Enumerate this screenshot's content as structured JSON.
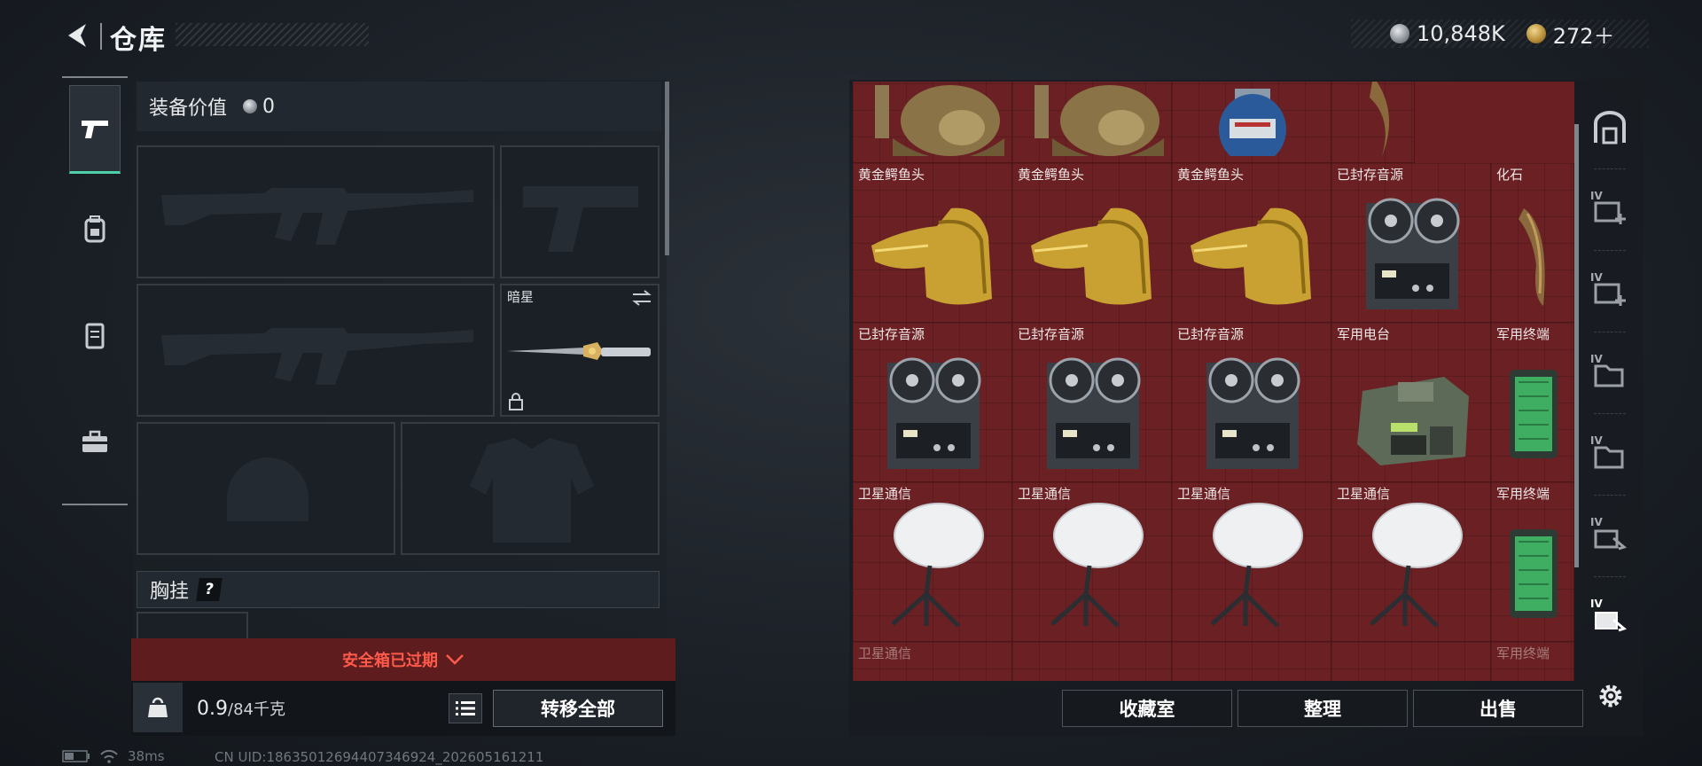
{
  "header": {
    "title": "仓库",
    "currencies": [
      {
        "icon": "silver-coin-icon",
        "value": "10,848K"
      },
      {
        "icon": "gold-token-icon",
        "value": "272＋"
      }
    ]
  },
  "left_tabs": [
    {
      "icon": "pistol-icon",
      "active": true
    },
    {
      "icon": "backpack-icon",
      "active": false
    },
    {
      "icon": "vest-icon",
      "active": false
    },
    {
      "icon": "toolbox-icon",
      "active": false
    }
  ],
  "equipment": {
    "value_label": "装备价值",
    "value": "0",
    "slots": {
      "primary_1": "",
      "pistol": "",
      "primary_2": "",
      "melee": {
        "name": "暗星"
      },
      "helmet": "",
      "armor": ""
    },
    "chest_rig_label": "胸挂",
    "help_label": "?",
    "safe_box_status": "安全箱已过期",
    "weight_current": "0.9",
    "weight_max": "/84千克",
    "transfer_all_label": "转移全部"
  },
  "status": {
    "ping": "38ms",
    "uid": "CN UID:186350126944073469​24_202605161211"
  },
  "stash": {
    "row0": [
      {
        "name": "",
        "icon": "golden-bust-icon"
      },
      {
        "name": "",
        "icon": "golden-bust-icon"
      },
      {
        "name": "",
        "icon": "gas-canister-icon"
      },
      {
        "name": "",
        "icon": "claw-fossil-icon"
      }
    ],
    "row1": [
      {
        "name": "黄金鳄鱼头",
        "icon": "crocodile-head-icon"
      },
      {
        "name": "黄金鳄鱼头",
        "icon": "crocodile-head-icon"
      },
      {
        "name": "黄金鳄鱼头",
        "icon": "crocodile-head-icon"
      },
      {
        "name": "已封存音源",
        "icon": "reel-recorder-icon"
      },
      {
        "name": "化石",
        "icon": "claw-fossil-icon"
      }
    ],
    "row2": [
      {
        "name": "已封存音源",
        "icon": "reel-recorder-icon"
      },
      {
        "name": "已封存音源",
        "icon": "reel-recorder-icon"
      },
      {
        "name": "已封存音源",
        "icon": "reel-recorder-icon"
      },
      {
        "name": "军用电台",
        "icon": "military-radio-icon"
      },
      {
        "name": "军用终端",
        "icon": "military-terminal-icon"
      }
    ],
    "row3": [
      {
        "name": "卫星通信",
        "icon": "satellite-dish-icon"
      },
      {
        "name": "卫星通信",
        "icon": "satellite-dish-icon"
      },
      {
        "name": "卫星通信",
        "icon": "satellite-dish-icon"
      },
      {
        "name": "卫星通信",
        "icon": "satellite-dish-icon"
      },
      {
        "name": "军用终端",
        "icon": "military-terminal-icon"
      }
    ],
    "row4": [
      {
        "name": "卫星通信"
      },
      {
        "name": ""
      },
      {
        "name": ""
      },
      {
        "name": ""
      },
      {
        "name": "军用终端"
      }
    ]
  },
  "right_tabs": [
    {
      "icon": "stash-overview-icon",
      "badge": ""
    },
    {
      "icon": "add-storage-icon",
      "badge": "IV"
    },
    {
      "icon": "add-storage-icon",
      "badge": "IV"
    },
    {
      "icon": "storage-folder-icon",
      "badge": "IV"
    },
    {
      "icon": "storage-folder-icon",
      "badge": "IV"
    },
    {
      "icon": "storage-hand-icon",
      "badge": "IV"
    },
    {
      "icon": "storage-hand-icon",
      "badge": "IV"
    }
  ],
  "actions": {
    "collection_label": "收藏室",
    "organize_label": "整理",
    "sell_label": "出售"
  }
}
